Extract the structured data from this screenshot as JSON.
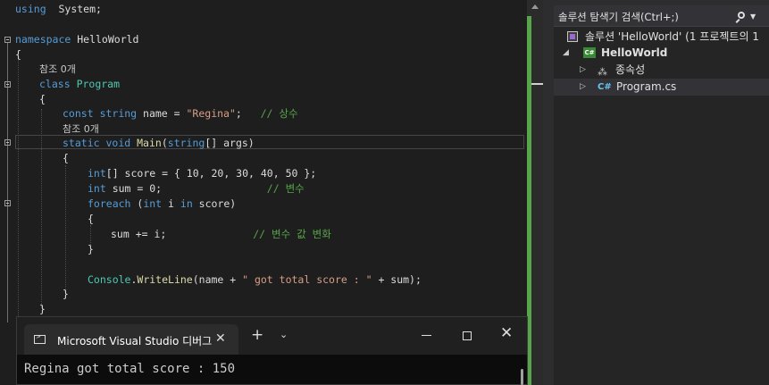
{
  "editor": {
    "lines": [
      {
        "segments": [
          [
            "kw",
            "using"
          ],
          [
            "",
            "  System;"
          ]
        ]
      },
      {
        "segments": []
      },
      {
        "segments": [
          [
            "kw",
            "namespace"
          ],
          [
            "ns",
            " HelloWorld"
          ]
        ]
      },
      {
        "segments": [
          [
            "",
            "{"
          ]
        ]
      },
      {
        "segments": [
          [
            "ref",
            "참조 0개"
          ]
        ]
      },
      {
        "segments": [
          [
            "kw",
            "class"
          ],
          [
            "",
            " "
          ],
          [
            "ty",
            "Program"
          ]
        ]
      },
      {
        "segments": [
          [
            "",
            "{"
          ]
        ]
      },
      {
        "segments": [
          [
            "kw",
            "const"
          ],
          [
            "",
            " "
          ],
          [
            "kw",
            "string"
          ],
          [
            "",
            " name = "
          ],
          [
            "st",
            "\"Regina\""
          ],
          [
            "",
            ";   "
          ],
          [
            "cm",
            "// 상수"
          ]
        ]
      },
      {
        "segments": [
          [
            "ref",
            "참조 0개"
          ]
        ]
      },
      {
        "segments": [
          [
            "kw",
            "static"
          ],
          [
            "",
            " "
          ],
          [
            "kw",
            "void"
          ],
          [
            "",
            " "
          ],
          [
            "fn",
            "Main"
          ],
          [
            "",
            "("
          ],
          [
            "kw",
            "string"
          ],
          [
            "",
            "[] "
          ],
          [
            "",
            "args"
          ],
          [
            "",
            ")"
          ]
        ]
      },
      {
        "segments": [
          [
            "",
            "{"
          ]
        ]
      },
      {
        "segments": [
          [
            "kw",
            "int"
          ],
          [
            "",
            "[] score = { 10, 20, 30, 40, 50 };"
          ]
        ]
      },
      {
        "segments": [
          [
            "kw",
            "int"
          ],
          [
            "",
            " sum = 0;                 "
          ],
          [
            "cm",
            "// 변수"
          ]
        ]
      },
      {
        "segments": [
          [
            "kw",
            "foreach"
          ],
          [
            "",
            " ("
          ],
          [
            "kw",
            "int"
          ],
          [
            "",
            " i "
          ],
          [
            "kw",
            "in"
          ],
          [
            "",
            " score)"
          ]
        ]
      },
      {
        "segments": [
          [
            "",
            "{"
          ]
        ]
      },
      {
        "segments": [
          [
            "",
            "sum += i;              "
          ],
          [
            "cm",
            "// 변수 값 변화"
          ]
        ]
      },
      {
        "segments": [
          [
            "",
            "}"
          ]
        ]
      },
      {
        "segments": []
      },
      {
        "segments": [
          [
            "ty",
            "Console"
          ],
          [
            "",
            "."
          ],
          [
            "fn",
            "WriteLine"
          ],
          [
            "",
            "(name + "
          ],
          [
            "st",
            "\" got total score : \""
          ],
          [
            "",
            " + sum);"
          ]
        ]
      },
      {
        "segments": [
          [
            "",
            "}"
          ]
        ]
      },
      {
        "segments": [
          [
            "",
            "}"
          ]
        ]
      }
    ]
  },
  "solution_explorer": {
    "search_placeholder": "솔루션 탐색기 검색(Ctrl+;)",
    "solution_label": "솔루션 'HelloWorld' (1 프로젝트의 1",
    "project_label": "HelloWorld",
    "project_badge": "C#",
    "dependencies_label": "종속성",
    "file_badge": "C#",
    "file_label": "Program.cs"
  },
  "console": {
    "tab_title": "Microsoft Visual Studio 디버그",
    "output": "Regina got total score : 150",
    "close_glyph": "✕",
    "plus_glyph": "+",
    "chevron_glyph": "⌄"
  },
  "colors": {
    "keyword": "#569cd6",
    "type": "#4ec9b0",
    "string": "#d69d85",
    "comment": "#57a64a",
    "function": "#dcdcaa",
    "change_margin": "#57a64a"
  }
}
